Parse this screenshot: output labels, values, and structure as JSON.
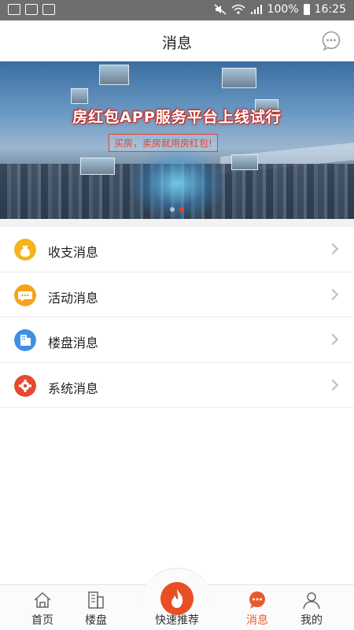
{
  "status_bar": {
    "battery": "100%",
    "time": "16:25"
  },
  "header": {
    "title": "消息",
    "chat_icon": "chat-bubble-icon"
  },
  "banner": {
    "headline": "房红包APP服务平台上线试行",
    "subline": "买房，卖房就用房红包!",
    "slides": 2,
    "active_slide": 1
  },
  "messages": [
    {
      "label": "收支消息",
      "icon": "money-bag-icon",
      "color": "#f6b31c"
    },
    {
      "label": "活动消息",
      "icon": "speech-bubble-icon",
      "color": "#f6a21c"
    },
    {
      "label": "楼盘消息",
      "icon": "building-icon",
      "color": "#3f8ee8"
    },
    {
      "label": "系统消息",
      "icon": "gear-icon",
      "color": "#e6492f"
    }
  ],
  "tabs": [
    {
      "label": "首页",
      "icon": "home-icon",
      "active": false
    },
    {
      "label": "楼盘",
      "icon": "building-icon",
      "active": false
    },
    {
      "label": "快速推荐",
      "icon": "fire-icon",
      "active": false
    },
    {
      "label": "消息",
      "icon": "message-icon",
      "active": true
    },
    {
      "label": "我的",
      "icon": "user-icon",
      "active": false
    }
  ],
  "colors": {
    "accent": "#e85a2c",
    "fab": "#ea4e24",
    "status_bar": "#6e6e6e"
  }
}
